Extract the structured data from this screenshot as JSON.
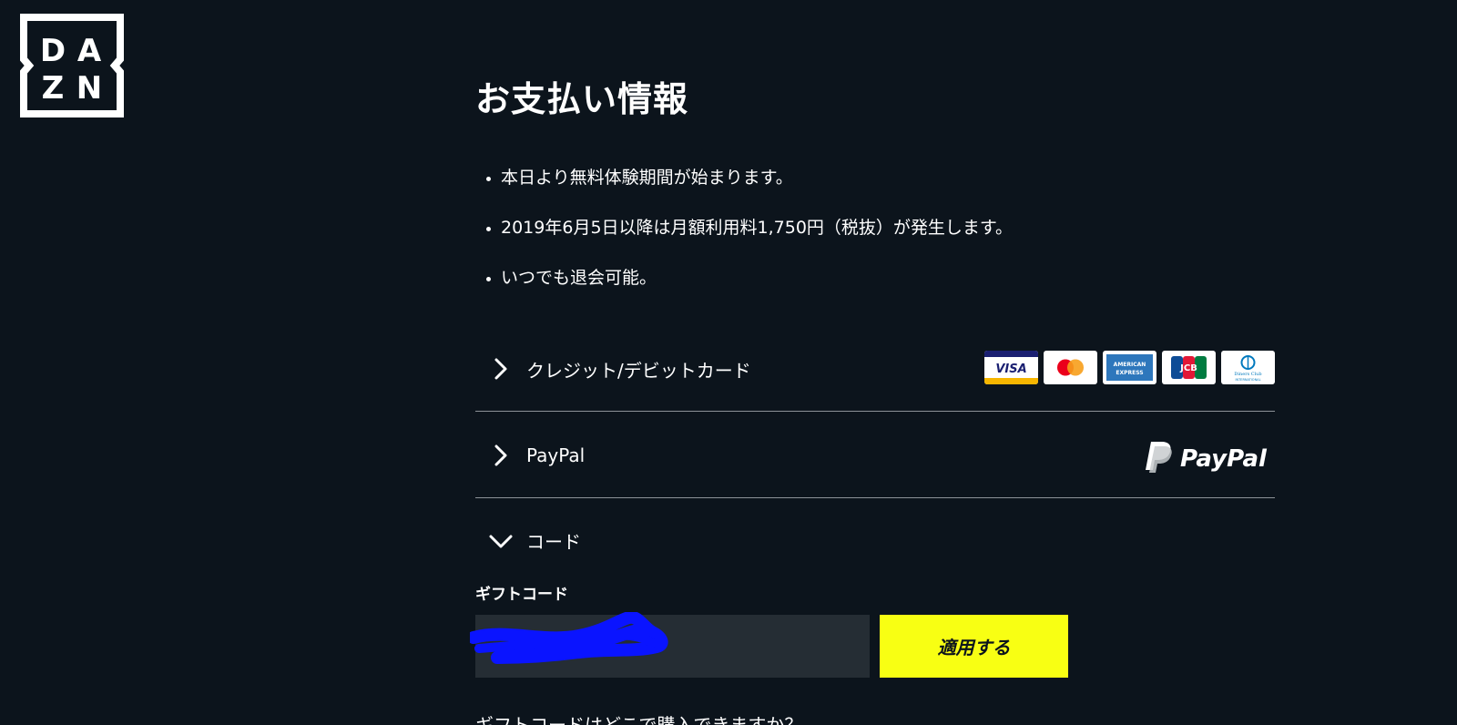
{
  "brand": {
    "logo_letters": [
      "D",
      "A",
      "Z",
      "N"
    ]
  },
  "page": {
    "title": "お支払い情報"
  },
  "bullets": [
    "本日より無料体験期間が始まります。",
    "2019年6月5日以降は月額利用料1,750円（税抜）が発生します。",
    "いつでも退会可能。"
  ],
  "payment_methods": {
    "credit_card": {
      "label": "クレジット/デビットカード",
      "expanded": false,
      "card_brands": [
        "VISA",
        "Mastercard",
        "American Express",
        "JCB",
        "Diners Club International"
      ]
    },
    "paypal": {
      "label": "PayPal",
      "expanded": false,
      "logo_text": "PayPal"
    },
    "code": {
      "label": "コード",
      "expanded": true
    }
  },
  "gift_code": {
    "label": "ギフトコード",
    "input_value": "",
    "apply_label": "適用する",
    "help_text": "ギフトコードはどこで購入できますか？"
  },
  "colors": {
    "background": "#0c141c",
    "accent_yellow": "#f8ff13",
    "input_background": "#252d34",
    "divider": "#8d9298",
    "redaction": "#0a14ff"
  },
  "card_text": {
    "visa": "VISA",
    "amex_line1": "AMERICAN",
    "amex_line2": "EXPRESS",
    "jcb": "JCB",
    "diners_line1": "Diners Club",
    "diners_line2": "INTERNATIONAL"
  }
}
